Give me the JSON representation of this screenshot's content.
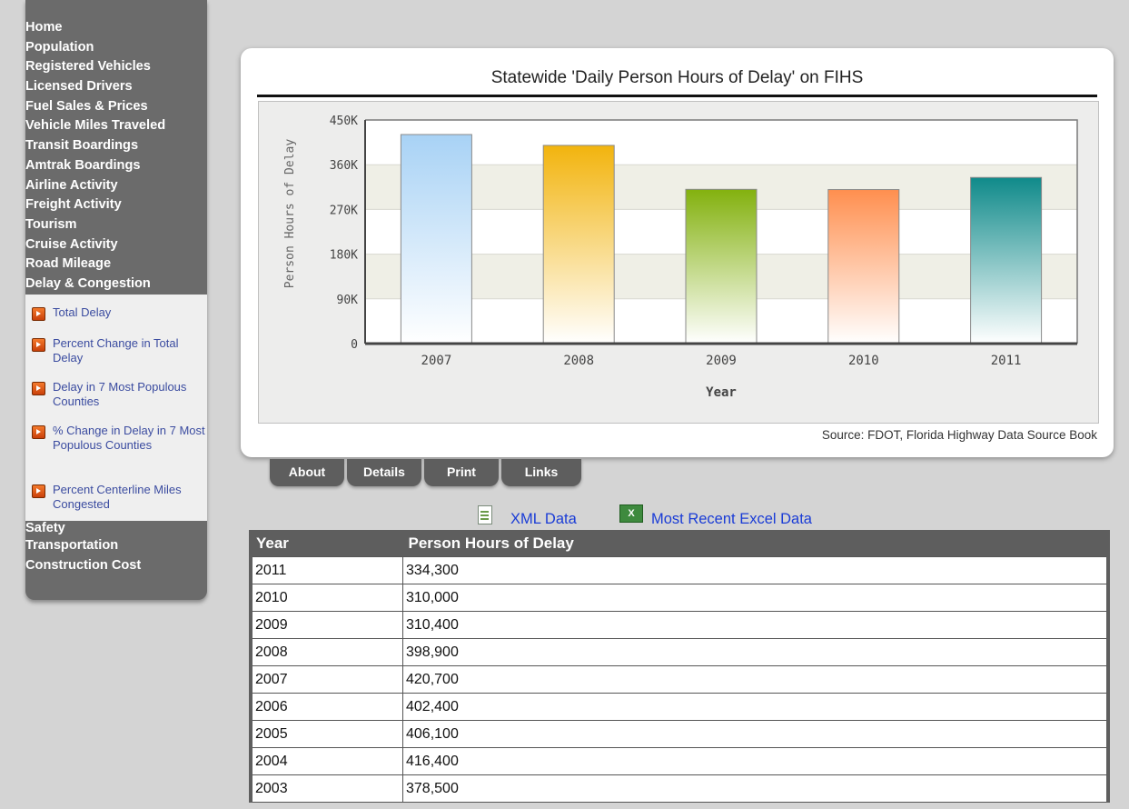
{
  "sidebar": {
    "nav_top": [
      "Home",
      "Population",
      "Registered Vehicles",
      "Licensed Drivers",
      "Fuel Sales & Prices",
      "Vehicle Miles Traveled",
      "Transit Boardings",
      "Amtrak Boardings",
      "Airline Activity",
      "Freight Activity",
      "Tourism",
      "Cruise Activity",
      "Road Mileage",
      "Delay & Congestion"
    ],
    "submenu": [
      "Total Delay",
      "Percent Change in Total Delay",
      "Delay in 7 Most Populous Counties",
      "% Change in Delay in 7 Most Populous Counties",
      "Percent Centerline Miles Congested"
    ],
    "nav_bottom": [
      "Safety",
      "Transportation",
      "Construction Cost"
    ]
  },
  "chart": {
    "title": "Statewide 'Daily Person Hours of Delay' on FIHS",
    "source": "Source: FDOT, Florida Highway Data Source Book"
  },
  "chart_data": {
    "type": "bar",
    "categories": [
      "2007",
      "2008",
      "2009",
      "2010",
      "2011"
    ],
    "values": [
      420700,
      398900,
      310400,
      310000,
      334300
    ],
    "colors": [
      "#a8d2f5",
      "#f2b40e",
      "#83b10e",
      "#ff8f4f",
      "#0f8a8a"
    ],
    "xlabel": "Year",
    "ylabel": "Person Hours of Delay",
    "ylim": [
      0,
      450000
    ],
    "yticks": [
      "0",
      "90K",
      "180K",
      "270K",
      "360K",
      "450K"
    ],
    "grid": true
  },
  "tabs": [
    "About",
    "Details",
    "Print",
    "Links"
  ],
  "links": {
    "xml": "XML Data",
    "excel": "Most Recent Excel Data",
    "excel_icon_text": "X"
  },
  "table": {
    "headers": [
      "Year",
      "Person Hours of Delay"
    ],
    "rows": [
      [
        "2011",
        "334,300"
      ],
      [
        "2010",
        "310,000"
      ],
      [
        "2009",
        "310,400"
      ],
      [
        "2008",
        "398,900"
      ],
      [
        "2007",
        "420,700"
      ],
      [
        "2006",
        "402,400"
      ],
      [
        "2005",
        "406,100"
      ],
      [
        "2004",
        "416,400"
      ],
      [
        "2003",
        "378,500"
      ]
    ]
  }
}
